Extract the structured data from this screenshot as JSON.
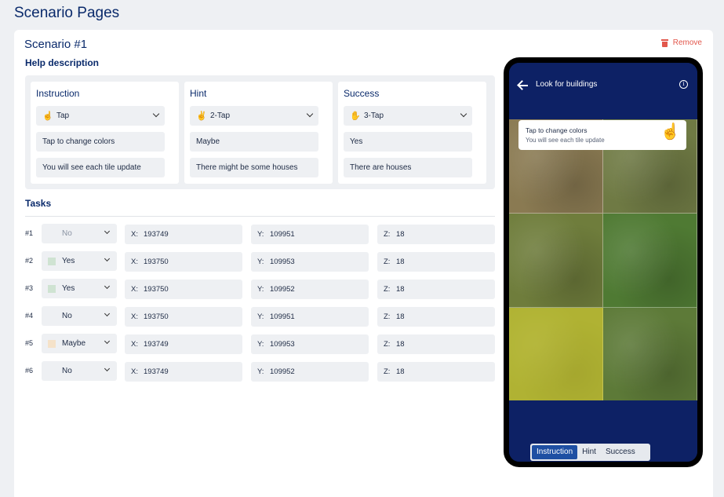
{
  "page": {
    "title": "Scenario Pages"
  },
  "scenario": {
    "title": "Scenario #1",
    "remove_label": "Remove",
    "help_description_label": "Help description",
    "tasks_label": "Tasks",
    "help_columns": [
      {
        "title": "Instruction",
        "gesture_icon": "tap-gesture-icon",
        "gesture": "Tap",
        "line1": "Tap to change colors",
        "line2": "You will see each tile update"
      },
      {
        "title": "Hint",
        "gesture_icon": "double-tap-gesture-icon",
        "gesture": "2-Tap",
        "line1": "Maybe",
        "line2": "There might be some houses"
      },
      {
        "title": "Success",
        "gesture_icon": "triple-tap-gesture-icon",
        "gesture": "3-Tap",
        "line1": "Yes",
        "line2": "There are houses"
      }
    ],
    "tasks": [
      {
        "num": "#1",
        "answer": "No",
        "answer_color": "",
        "answer_muted": true,
        "x_label": "X:",
        "x": "193749",
        "y_label": "Y:",
        "y": "109951",
        "z_label": "Z:",
        "z": "18"
      },
      {
        "num": "#2",
        "answer": "Yes",
        "answer_color": "#cfe3d2",
        "answer_muted": false,
        "x_label": "X:",
        "x": "193750",
        "y_label": "Y:",
        "y": "109953",
        "z_label": "Z:",
        "z": "18"
      },
      {
        "num": "#3",
        "answer": "Yes",
        "answer_color": "#cfe3d2",
        "answer_muted": false,
        "x_label": "X:",
        "x": "193750",
        "y_label": "Y:",
        "y": "109952",
        "z_label": "Z:",
        "z": "18"
      },
      {
        "num": "#4",
        "answer": "No",
        "answer_color": "",
        "answer_muted": false,
        "x_label": "X:",
        "x": "193750",
        "y_label": "Y:",
        "y": "109951",
        "z_label": "Z:",
        "z": "18"
      },
      {
        "num": "#5",
        "answer": "Maybe",
        "answer_color": "#f5e2c9",
        "answer_muted": false,
        "x_label": "X:",
        "x": "193749",
        "y_label": "Y:",
        "y": "109953",
        "z_label": "Z:",
        "z": "18"
      },
      {
        "num": "#6",
        "answer": "No",
        "answer_color": "",
        "answer_muted": false,
        "x_label": "X:",
        "x": "193749",
        "y_label": "Y:",
        "y": "109952",
        "z_label": "Z:",
        "z": "18"
      }
    ]
  },
  "preview": {
    "title": "Look for buildings",
    "info_symbol": "i",
    "tip_title": "Tap to change colors",
    "tip_subtitle": "You will see each tile update",
    "tip_icon": "hand-pointer-icon",
    "tile_colors": [
      "#8a7a52",
      "#6f7a44",
      "#6f7d3c",
      "#4f7a33",
      "#7e8d3a",
      "#5d7a38"
    ],
    "tile_overlays": [
      "",
      "",
      "",
      "",
      "#d9d22e",
      ""
    ],
    "tabs": [
      {
        "label": "Instruction",
        "active": true
      },
      {
        "label": "Hint",
        "active": false
      },
      {
        "label": "Success",
        "active": false
      }
    ]
  },
  "colors": {
    "brand_navy": "#0d2165",
    "accent_blue": "#1e4fa3",
    "remove_red": "#e2574c"
  }
}
